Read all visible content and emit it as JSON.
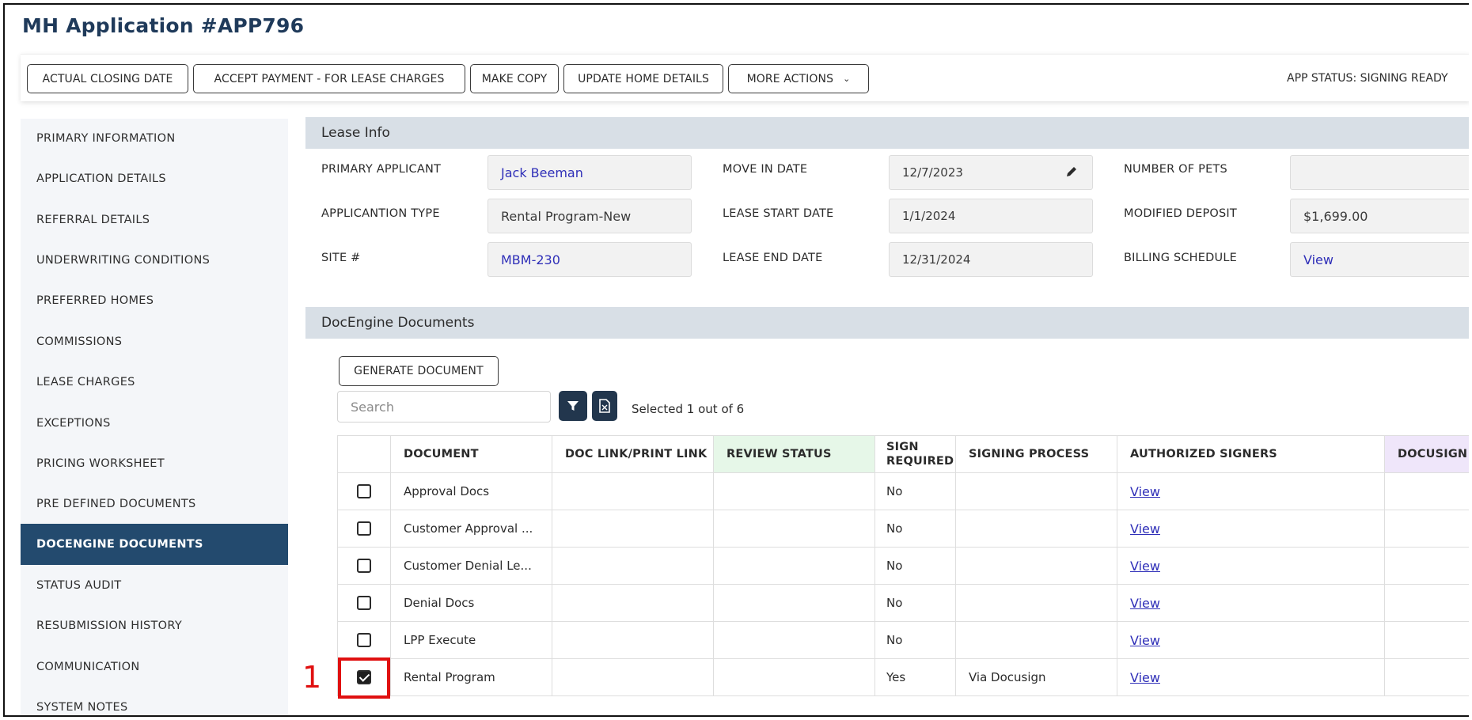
{
  "header": {
    "title": "MH Application #APP796"
  },
  "toolbar": {
    "buttons": [
      "ACTUAL CLOSING DATE",
      "ACCEPT PAYMENT - FOR LEASE CHARGES",
      "MAKE COPY",
      "UPDATE HOME DETAILS",
      "MORE ACTIONS"
    ],
    "app_status": "APP STATUS: SIGNING READY"
  },
  "sidebar": {
    "items": [
      "PRIMARY INFORMATION",
      "APPLICATION DETAILS",
      "REFERRAL DETAILS",
      "UNDERWRITING CONDITIONS",
      "PREFERRED HOMES",
      "COMMISSIONS",
      "LEASE CHARGES",
      "EXCEPTIONS",
      "PRICING WORKSHEET",
      "PRE DEFINED DOCUMENTS",
      "DOCENGINE DOCUMENTS",
      "STATUS AUDIT",
      "RESUBMISSION HISTORY",
      "COMMUNICATION",
      "SYSTEM NOTES"
    ],
    "active_index": 10
  },
  "lease_info": {
    "heading": "Lease Info",
    "fields": {
      "primary_applicant": {
        "label": "PRIMARY APPLICANT",
        "value": "Jack Beeman"
      },
      "application_type": {
        "label": "APPLICANTION TYPE",
        "value": "Rental Program-New"
      },
      "site": {
        "label": "SITE #",
        "value": "MBM-230"
      },
      "move_in_date": {
        "label": "MOVE IN DATE",
        "value": "12/7/2023"
      },
      "lease_start_date": {
        "label": "LEASE START DATE",
        "value": "1/1/2024"
      },
      "lease_end_date": {
        "label": "LEASE END DATE",
        "value": "12/31/2024"
      },
      "number_of_pets": {
        "label": "NUMBER OF PETS",
        "value": ""
      },
      "modified_deposit": {
        "label": "MODIFIED DEPOSIT",
        "value": "$1,699.00"
      },
      "billing_schedule": {
        "label": "BILLING SCHEDULE",
        "value": "View"
      }
    }
  },
  "docengine": {
    "heading": "DocEngine Documents",
    "generate_label": "GENERATE DOCUMENT",
    "search_placeholder": "Search",
    "selected_text": "Selected 1 out of 6",
    "columns": [
      "DOCUMENT",
      "DOC LINK/PRINT LINK",
      "REVIEW STATUS",
      "SIGN REQUIRED",
      "SIGNING PROCESS",
      "AUTHORIZED SIGNERS",
      "DOCUSIGN S"
    ],
    "rows": [
      {
        "checked": false,
        "document": "Approval Docs",
        "sign_required": "No",
        "signing_process": "",
        "authorized": "View"
      },
      {
        "checked": false,
        "document": "Customer Approval ...",
        "sign_required": "No",
        "signing_process": "",
        "authorized": "View"
      },
      {
        "checked": false,
        "document": "Customer Denial Le...",
        "sign_required": "No",
        "signing_process": "",
        "authorized": "View"
      },
      {
        "checked": false,
        "document": "Denial Docs",
        "sign_required": "No",
        "signing_process": "",
        "authorized": "View"
      },
      {
        "checked": false,
        "document": "LPP Execute",
        "sign_required": "No",
        "signing_process": "",
        "authorized": "View"
      },
      {
        "checked": true,
        "document": "Rental Program",
        "sign_required": "Yes",
        "signing_process": "Via Docusign",
        "authorized": "View"
      }
    ]
  },
  "annotation": {
    "label": "1",
    "color": "#e01010"
  },
  "colors": {
    "primary": "#234a6e",
    "link": "#2f2fb8",
    "section_bg": "#d8dfe6",
    "review_header": "#e6f7e8",
    "docusign_header": "#efe6fa"
  }
}
